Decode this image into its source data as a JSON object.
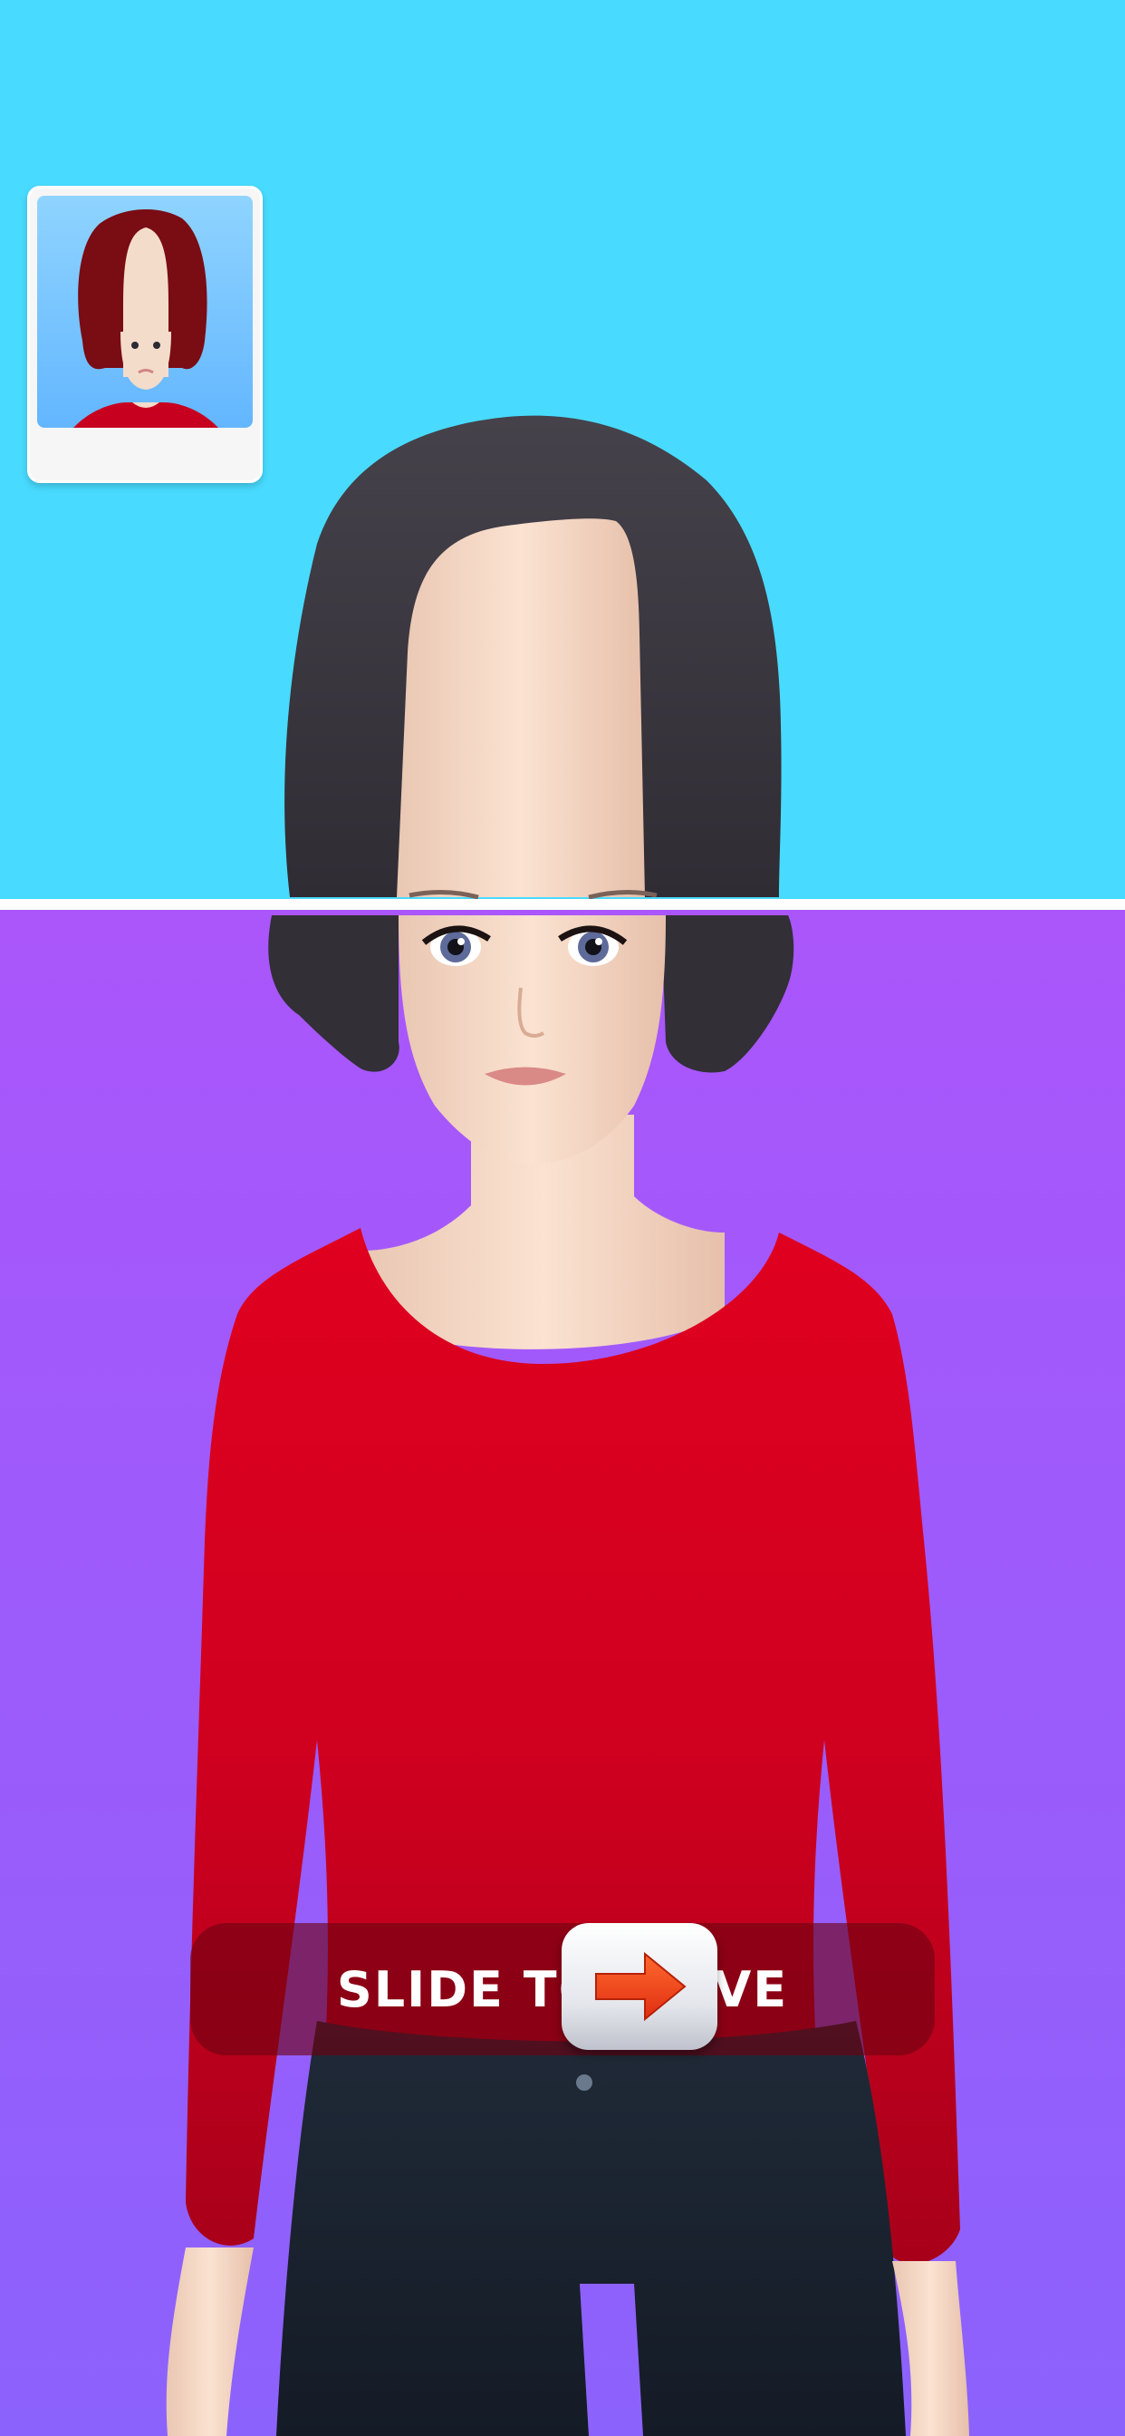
{
  "game": {
    "title": "",
    "reference_card": {
      "label": ""
    },
    "slider": {
      "text": "SLIDE TO MOVE"
    },
    "colors": {
      "top_background": "#48dbff",
      "bottom_background": "#a95bfb",
      "divider": "#ffffff",
      "hair_main": "#3a363f",
      "hair_reference": "#7a0c14",
      "shirt": "#c6001f",
      "jeans": "#1b2533",
      "skin": "#f3d8c6"
    },
    "icons": {
      "slider_handle": "arrow-right-icon"
    }
  }
}
